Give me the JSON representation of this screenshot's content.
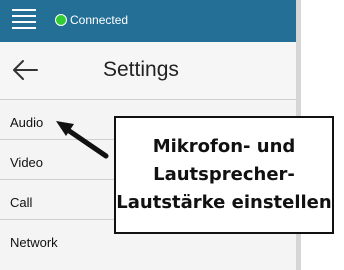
{
  "status_bar": {
    "connection_status": "Connected",
    "menu_icon": "hamburger-menu-icon",
    "status_indicator_color": "#33cc33",
    "background_color": "#236f95"
  },
  "header": {
    "back_icon": "arrow-left-icon",
    "title": "Settings"
  },
  "menu": {
    "items": [
      {
        "label": "Audio"
      },
      {
        "label": "Video"
      },
      {
        "label": "Call"
      },
      {
        "label": "Network"
      }
    ]
  },
  "annotation": {
    "lines": [
      "Mikrofon- und",
      "Lautsprecher-",
      "Lautstärke einstellen"
    ],
    "points_to": "Audio"
  }
}
